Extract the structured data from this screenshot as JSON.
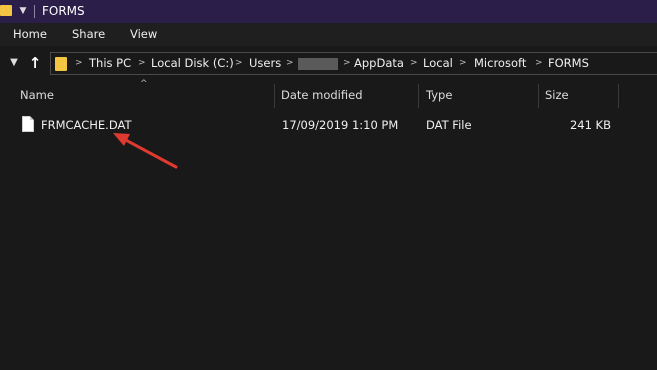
{
  "window": {
    "title": "FORMS"
  },
  "ribbon": {
    "tabs": [
      "Home",
      "Share",
      "View"
    ]
  },
  "address": {
    "crumbs": [
      "This PC",
      "Local Disk (C:)",
      "Users",
      "AppData",
      "Local",
      "Microsoft",
      "FORMS"
    ]
  },
  "columns": {
    "name": "Name",
    "date": "Date modified",
    "type": "Type",
    "size": "Size"
  },
  "files": [
    {
      "name": "FRMCACHE.DAT",
      "date": "17/09/2019 1:10 PM",
      "type": "DAT File",
      "size": "241 KB"
    }
  ],
  "colors": {
    "titlebar": "#2b1f4a",
    "background": "#191919",
    "annotation_arrow": "#e03a30",
    "folder": "#f4c542"
  },
  "icons": {
    "titlebar": "folder-icon",
    "file": "file-icon",
    "up": "up-arrow-icon",
    "history": "chevron-down-icon"
  }
}
